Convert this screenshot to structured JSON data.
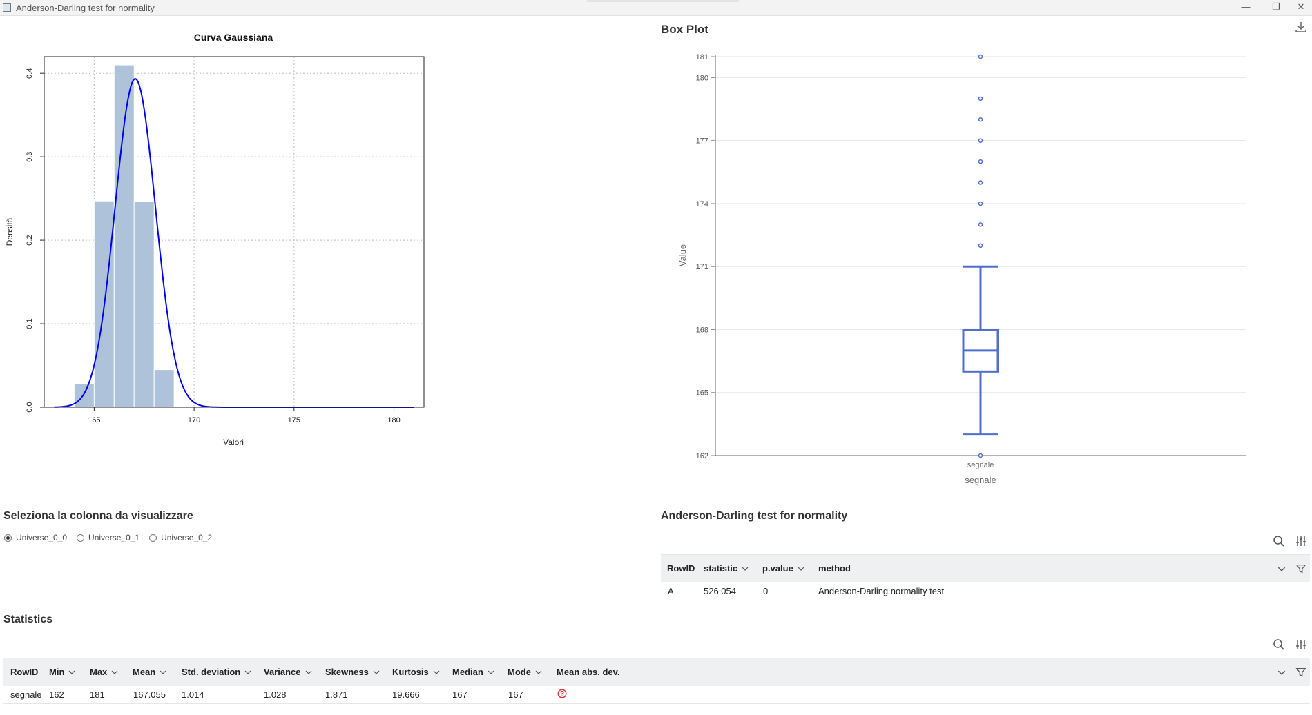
{
  "window": {
    "title": "Anderson-Darling test for normality",
    "minimize": "—",
    "restore": "❐",
    "close": "✕"
  },
  "histogram": {
    "title": "Curva Gaussiana",
    "xlabel": "Valori",
    "ylabel": "Densità",
    "x_ticks": [
      "165",
      "170",
      "175",
      "180"
    ],
    "y_ticks": [
      "0.0",
      "0.1",
      "0.2",
      "0.3",
      "0.4"
    ]
  },
  "boxplot": {
    "title": "Box Plot",
    "ylabel": "Value",
    "category_label": "segnale",
    "xlabel": "segnale",
    "y_ticks": [
      "162",
      "165",
      "168",
      "171",
      "174",
      "177",
      "180",
      "181"
    ],
    "download_icon": "download-icon"
  },
  "chart_data": [
    {
      "type": "bar",
      "title": "Curva Gaussiana",
      "xlabel": "Valori",
      "ylabel": "Densità",
      "xlim": [
        162.5,
        181.5
      ],
      "ylim": [
        0,
        0.42
      ],
      "bins": [
        {
          "x0": 164,
          "x1": 165,
          "value": 0.028
        },
        {
          "x0": 165,
          "x1": 166,
          "value": 0.247
        },
        {
          "x0": 166,
          "x1": 167,
          "value": 0.41
        },
        {
          "x0": 167,
          "x1": 168,
          "value": 0.246
        },
        {
          "x0": 168,
          "x1": 169,
          "value": 0.045
        },
        {
          "x0": 169,
          "x1": 170,
          "value": 0.001
        }
      ],
      "curve": {
        "type": "line",
        "mean": 167.055,
        "sd": 1.014,
        "x_range": [
          163,
          181
        ]
      }
    },
    {
      "type": "box",
      "title": "Box Plot",
      "ylabel": "Value",
      "category": "segnale",
      "ylim": [
        162,
        181
      ],
      "min": 163,
      "q1": 166,
      "median": 167,
      "q3": 168,
      "max": 171,
      "outliers": [
        162,
        172,
        173,
        174,
        175,
        176,
        177,
        178,
        179,
        181
      ]
    }
  ],
  "column_selector": {
    "title": "Seleziona la colonna da visualizzare",
    "options": [
      "Universe_0_0",
      "Universe_0_1",
      "Universe_0_2"
    ],
    "selected": "Universe_0_0"
  },
  "ad_test": {
    "title": "Anderson-Darling test for normality",
    "columns": [
      "RowID",
      "statistic",
      "p.value",
      "method"
    ],
    "rows": [
      [
        "A",
        "526.054",
        "0",
        "Anderson-Darling normality test"
      ]
    ]
  },
  "statistics": {
    "title": "Statistics",
    "columns": [
      "RowID",
      "Min",
      "Max",
      "Mean",
      "Std. deviation",
      "Variance",
      "Skewness",
      "Kurtosis",
      "Median",
      "Mode",
      "Mean abs. dev."
    ],
    "rows": [
      [
        "segnale",
        "162",
        "181",
        "167.055",
        "1.014",
        "1.028",
        "1.871",
        "19.666",
        "167",
        "167",
        ""
      ]
    ],
    "warning_icon": "warning-icon"
  },
  "colors": {
    "hist_bar": "#aec3d9",
    "normal_curve": "#0000ee",
    "box": "#4f6fcf",
    "warning": "#d63333"
  }
}
